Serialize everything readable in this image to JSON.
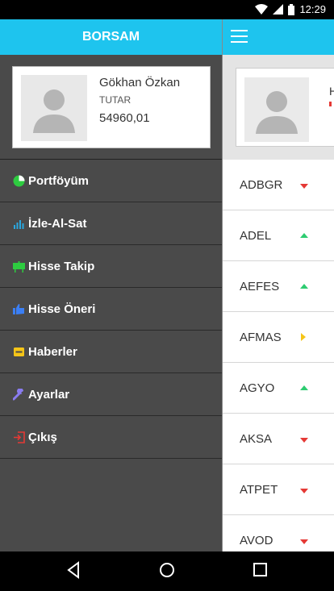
{
  "status_bar": {
    "time": "12:29"
  },
  "drawer": {
    "title": "BORSAM",
    "profile": {
      "name": "Gökhan Özkan",
      "label": "TUTAR",
      "amount": "54960,01"
    },
    "menu": [
      {
        "label": "Portföyüm",
        "icon": "pie-chart-icon",
        "color": "#2ecc40"
      },
      {
        "label": "İzle-Al-Sat",
        "icon": "bar-chart-icon",
        "color": "#29a8e0"
      },
      {
        "label": "Hisse Takip",
        "icon": "presentation-board-icon",
        "color": "#2ecc40"
      },
      {
        "label": "Hisse Öneri",
        "icon": "thumbs-up-icon",
        "color": "#3b7ff5"
      },
      {
        "label": "Haberler",
        "icon": "newspaper-icon",
        "color": "#f5c518"
      },
      {
        "label": "Ayarlar",
        "icon": "wrench-icon",
        "color": "#8a7cf0"
      },
      {
        "label": "Çıkış",
        "icon": "exit-icon",
        "color": "#e53935"
      }
    ]
  },
  "main": {
    "profile_peek": "H",
    "stocks": [
      {
        "code": "ADBGR",
        "trend": "down",
        "color": "#e53935"
      },
      {
        "code": "ADEL",
        "trend": "up",
        "color": "#2ecc71"
      },
      {
        "code": "AEFES",
        "trend": "up",
        "color": "#2ecc71"
      },
      {
        "code": "AFMAS",
        "trend": "neutral",
        "color": "#f5c518"
      },
      {
        "code": "AGYO",
        "trend": "up",
        "color": "#2ecc71"
      },
      {
        "code": "AKSA",
        "trend": "down",
        "color": "#e53935"
      },
      {
        "code": "ATPET",
        "trend": "down",
        "color": "#e53935"
      },
      {
        "code": "AVOD",
        "trend": "down",
        "color": "#e53935"
      }
    ]
  },
  "colors": {
    "accent": "#1ec4ee",
    "drawer_bg": "#4a4a4a"
  }
}
